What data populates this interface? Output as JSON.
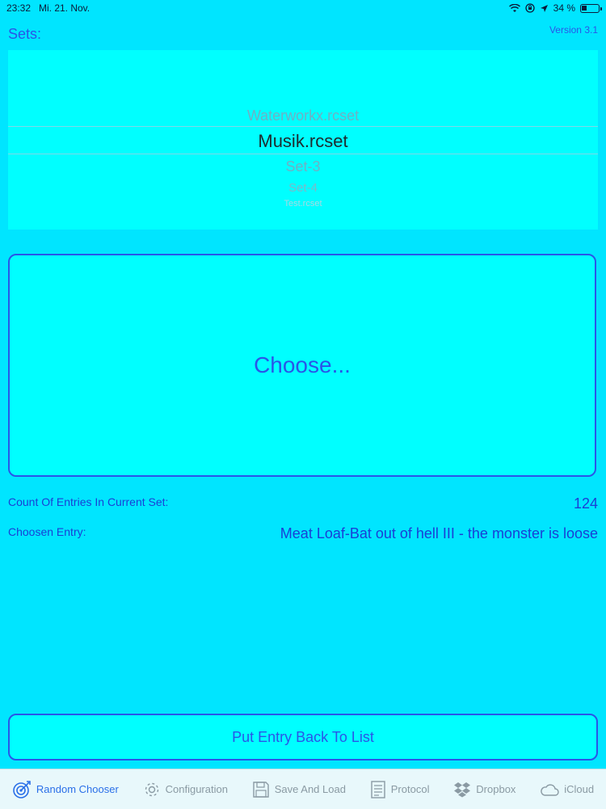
{
  "status": {
    "time": "23:32",
    "date": "Mi. 21. Nov.",
    "battery": "34 %",
    "battery_level": 0.34
  },
  "header": {
    "sets_label": "Sets:",
    "version": "Version 3.1"
  },
  "picker": {
    "items": [
      "Waterworkx.rcset",
      "Musik.rcset",
      "Set-3",
      "Set-4",
      "Test.rcset"
    ],
    "selected": "Musik.rcset"
  },
  "main": {
    "choose_label": "Choose..."
  },
  "info": {
    "count_label": "Count Of Entries In Current Set:",
    "count_value": "124",
    "entry_label": "Choosen Entry:",
    "entry_value": "Meat Loaf-Bat out of hell III - the monster is loose"
  },
  "put_back_label": "Put Entry Back To List",
  "tabs": [
    {
      "label": "Random Chooser",
      "icon": "target-icon",
      "active": true
    },
    {
      "label": "Configuration",
      "icon": "gear-icon",
      "active": false
    },
    {
      "label": "Save And Load",
      "icon": "floppy-disk-icon",
      "active": false
    },
    {
      "label": "Protocol",
      "icon": "document-icon",
      "active": false
    },
    {
      "label": "Dropbox",
      "icon": "dropbox-icon",
      "active": false
    },
    {
      "label": "iCloud",
      "icon": "cloud-icon",
      "active": false
    }
  ],
  "colors": {
    "background": "#00e5ff",
    "panel": "#00ffff",
    "accent": "#2a55e8",
    "tab_active": "#2a6fe8",
    "tab_inactive": "#8a9aa3"
  }
}
